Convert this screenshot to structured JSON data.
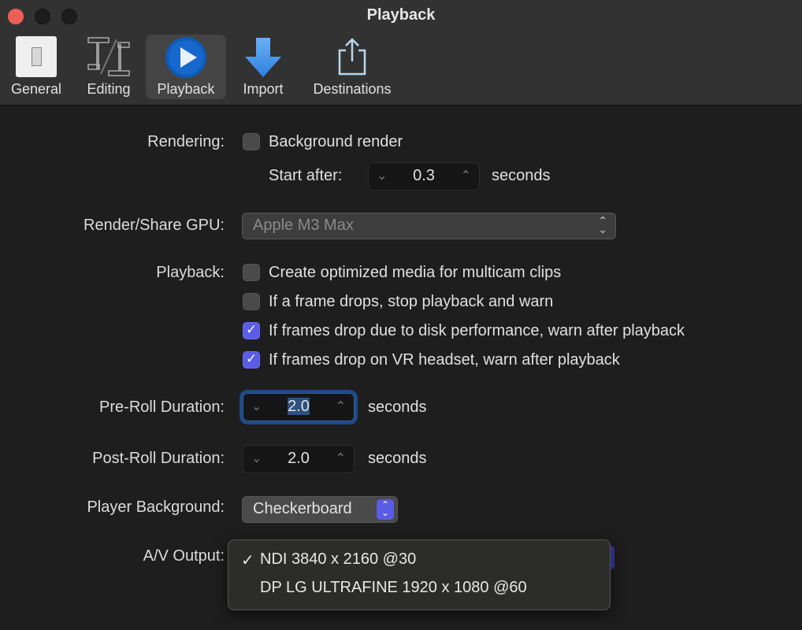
{
  "window": {
    "title": "Playback"
  },
  "toolbar": {
    "items": [
      {
        "label": "General",
        "icon": "switch-icon"
      },
      {
        "label": "Editing",
        "icon": "film-strip-icon"
      },
      {
        "label": "Playback",
        "icon": "play-circle-icon",
        "selected": true
      },
      {
        "label": "Import",
        "icon": "download-arrow-icon"
      },
      {
        "label": "Destinations",
        "icon": "share-icon"
      }
    ]
  },
  "rendering": {
    "label": "Rendering:",
    "background_render": {
      "label": "Background render",
      "checked": false
    },
    "start_after": {
      "label": "Start after:",
      "value": "0.3",
      "unit": "seconds"
    }
  },
  "gpu": {
    "label": "Render/Share GPU:",
    "value": "Apple M3 Max"
  },
  "playback": {
    "label": "Playback:",
    "options": [
      {
        "label": "Create optimized media for multicam clips",
        "checked": false
      },
      {
        "label": "If a frame drops, stop playback and warn",
        "checked": false
      },
      {
        "label": "If frames drop due to disk performance, warn after playback",
        "checked": true
      },
      {
        "label": "If frames drop on VR headset, warn after playback",
        "checked": true
      }
    ]
  },
  "pre_roll": {
    "label": "Pre-Roll Duration:",
    "value": "2.0",
    "unit": "seconds"
  },
  "post_roll": {
    "label": "Post-Roll Duration:",
    "value": "2.0",
    "unit": "seconds"
  },
  "player_background": {
    "label": "Player Background:",
    "value": "Checkerboard"
  },
  "av_output": {
    "label": "A/V Output:",
    "menu": [
      {
        "label": "NDI 3840 x 2160 @30",
        "checked": true,
        "check_glyph": "✓"
      },
      {
        "label": "DP LG ULTRAFINE 1920 x 1080 @60",
        "checked": false
      }
    ]
  },
  "colors": {
    "accent": "#5a5ce6",
    "focus_ring": "#1f4a86",
    "close": "#ec5f57"
  }
}
